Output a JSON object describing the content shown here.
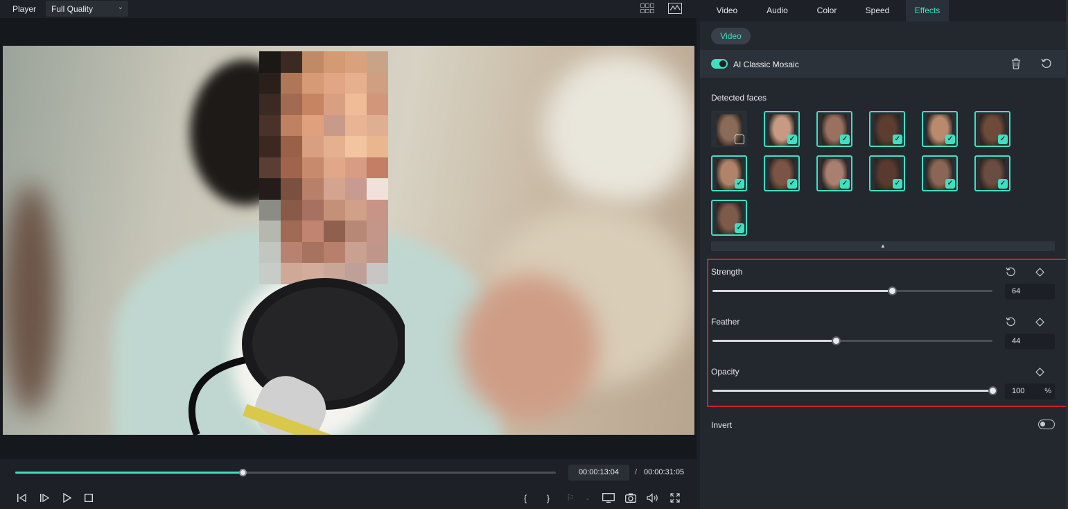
{
  "player": {
    "title": "Player",
    "quality": "Full Quality",
    "progress_fraction": 0.422,
    "time_current": "00:00:13:04",
    "time_separator": "/",
    "time_total": "00:00:31:05"
  },
  "tabs": [
    {
      "label": "Video"
    },
    {
      "label": "Audio"
    },
    {
      "label": "Color"
    },
    {
      "label": "Speed"
    },
    {
      "label": "Effects",
      "active": true
    }
  ],
  "subtab": "Video",
  "effect": {
    "name": "AI Classic Mosaic",
    "enabled": true
  },
  "faces": {
    "title": "Detected faces",
    "selected": [
      false,
      true,
      true,
      true,
      true,
      true,
      true,
      true,
      true,
      true,
      true,
      true,
      true
    ]
  },
  "params": {
    "strength": {
      "label": "Strength",
      "value": "64",
      "fraction": 0.64
    },
    "feather": {
      "label": "Feather",
      "value": "44",
      "fraction": 0.44
    },
    "opacity": {
      "label": "Opacity",
      "value": "100",
      "unit": "%",
      "fraction": 1.0
    }
  },
  "invert": {
    "label": "Invert",
    "enabled": false
  },
  "colors": {
    "accent": "#3fe0c2",
    "highlight_border": "#d0222c"
  }
}
